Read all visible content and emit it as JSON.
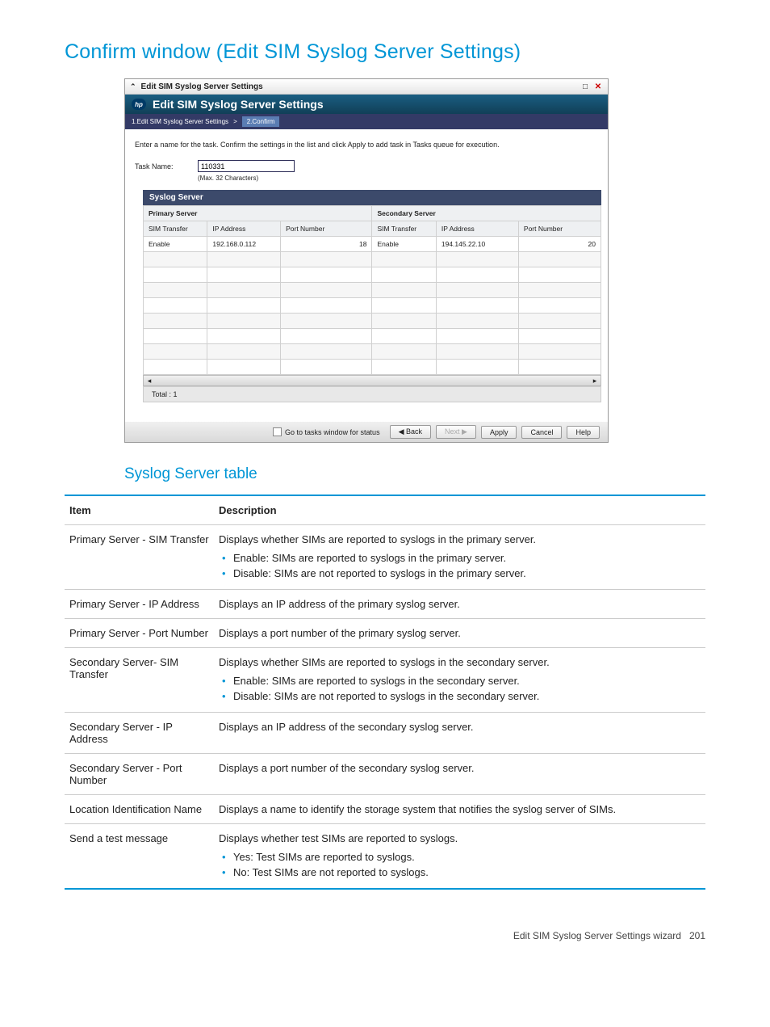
{
  "page": {
    "title": "Confirm window (Edit SIM Syslog Server Settings)"
  },
  "window": {
    "collapse_icon": "⌃",
    "title": "Edit SIM Syslog Server Settings",
    "banner_title": "Edit SIM Syslog Server Settings",
    "logo": "hp",
    "breadcrumb": {
      "step1": "1.Edit SIM Syslog Server Settings",
      "sep": ">",
      "step2": "2.Confirm"
    },
    "instructions": "Enter a name for the task. Confirm the settings in the list and click Apply to add task in Tasks queue for execution.",
    "task_name_label": "Task Name:",
    "task_name_value": "110331",
    "task_name_hint": "(Max. 32 Characters)",
    "syslog_header": "Syslog Server",
    "group_headers": {
      "primary": "Primary Server",
      "secondary": "Secondary Server"
    },
    "col_headers": {
      "sim": "SIM Transfer",
      "ip": "IP Address",
      "port": "Port Number"
    },
    "row": {
      "pri_sim": "Enable",
      "pri_ip": "192.168.0.112",
      "pri_port": "18",
      "sec_sim": "Enable",
      "sec_ip": "194.145.22.10",
      "sec_port": "20"
    },
    "total": "Total : 1",
    "footer": {
      "go_to_tasks": "Go to tasks window for status",
      "back": "◀ Back",
      "next": "Next ▶",
      "apply": "Apply",
      "cancel": "Cancel",
      "help": "Help"
    }
  },
  "section2_title": "Syslog Server table",
  "desc_headers": {
    "item": "Item",
    "desc": "Description"
  },
  "desc_rows": [
    {
      "item": "Primary Server - SIM Transfer",
      "text": "Displays whether SIMs are reported to syslogs in the primary server.",
      "bullets": [
        "Enable: SIMs are reported to syslogs in the primary server.",
        "Disable: SIMs are not reported to syslogs in the primary server."
      ]
    },
    {
      "item": "Primary Server - IP Address",
      "text": "Displays an IP address of the primary syslog server.",
      "bullets": []
    },
    {
      "item": "Primary Server - Port Number",
      "text": "Displays a port number of the primary syslog server.",
      "bullets": []
    },
    {
      "item": "Secondary Server- SIM Transfer",
      "text": "Displays whether SIMs are reported to syslogs in the secondary server.",
      "bullets": [
        "Enable: SIMs are reported to syslogs in the secondary server.",
        "Disable: SIMs are not reported to syslogs in the secondary server."
      ]
    },
    {
      "item": "Secondary Server - IP Address",
      "text": "Displays an IP address of the secondary syslog server.",
      "bullets": []
    },
    {
      "item": "Secondary Server - Port Number",
      "text": "Displays a port number of the secondary syslog server.",
      "bullets": []
    },
    {
      "item": "Location Identification Name",
      "text": "Displays a name to identify the storage system that notifies the syslog server of SIMs.",
      "bullets": []
    },
    {
      "item": "Send a test message",
      "text": "Displays whether test SIMs are reported to syslogs.",
      "bullets": [
        "Yes: Test SIMs are reported to syslogs.",
        "No: Test SIMs are not reported to syslogs."
      ]
    }
  ],
  "footer": {
    "text": "Edit SIM Syslog Server Settings wizard",
    "page_num": "201"
  }
}
